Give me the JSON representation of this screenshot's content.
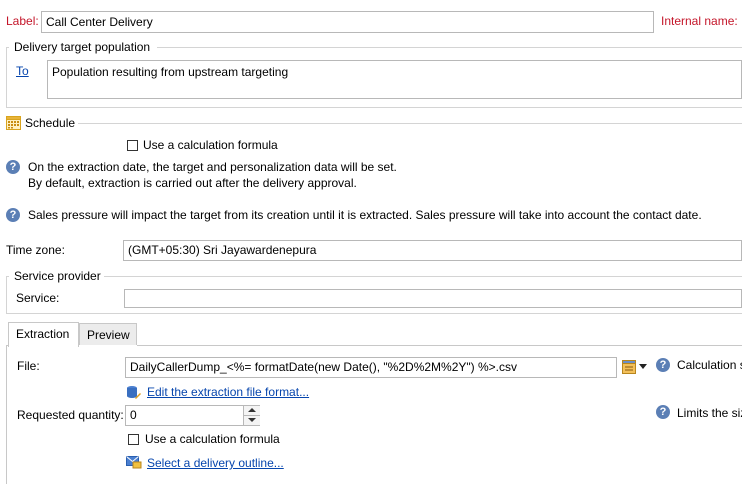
{
  "label_field": {
    "caption": "Label:",
    "value": "Call Center Delivery"
  },
  "internal_name": {
    "caption": "Internal name:"
  },
  "target_population": {
    "legend": "Delivery target population",
    "to_link": "To",
    "value": "Population resulting from upstream targeting"
  },
  "schedule": {
    "legend": "Schedule",
    "use_formula_label": "Use a calculation formula",
    "info_line1": "On the extraction date, the target and personalization data will be set.",
    "info_line2": "By default, extraction is carried out after the delivery approval.",
    "pressure_info": "Sales pressure will impact the target from its creation until it is extracted. Sales pressure will take into account the contact date."
  },
  "time_zone": {
    "caption": "Time zone:",
    "value": "(GMT+05:30) Sri Jayawardenepura"
  },
  "service_provider": {
    "legend": "Service provider",
    "service_caption": "Service:",
    "service_value": ""
  },
  "tabs": [
    {
      "label": "Extraction"
    },
    {
      "label": "Preview"
    }
  ],
  "extraction": {
    "file_caption": "File:",
    "file_value": "DailyCallerDump_<%= formatDate(new Date(), \"%2D%2M%2Y\") %>.csv",
    "calc_label": "Calculation s",
    "edit_format_link": "Edit the extraction file format...",
    "quantity_caption": "Requested quantity:",
    "quantity_value": "0",
    "limits_label": "Limits the siz",
    "use_formula_label": "Use a calculation formula",
    "outline_link": "Select a delivery outline..."
  },
  "colors": {
    "label_red": "#c4162a",
    "link_blue": "#0645ad",
    "info_blue": "#5b7fb5"
  }
}
